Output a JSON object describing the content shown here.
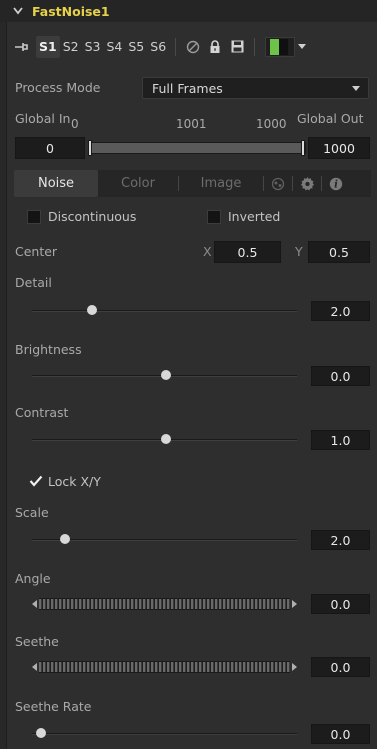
{
  "header": {
    "title": "FastNoise1"
  },
  "versions": [
    "S1",
    "S2",
    "S3",
    "S4",
    "S5",
    "S6"
  ],
  "version_active": "S1",
  "process_mode": {
    "label": "Process Mode",
    "value": "Full Frames"
  },
  "global_range": {
    "in_label": "Global In",
    "out_label": "Global Out",
    "start": "0",
    "mid": "1001",
    "end": "1000",
    "in_value": "0",
    "out_value": "1000"
  },
  "tabs": [
    "Noise",
    "Color",
    "Image"
  ],
  "tab_active": "Noise",
  "checkboxes": {
    "discontinuous": {
      "label": "Discontinuous",
      "checked": false
    },
    "inverted": {
      "label": "Inverted",
      "checked": false
    },
    "lock_xy": {
      "label": "Lock X/Y",
      "checked": true
    }
  },
  "center": {
    "label": "Center",
    "x_label": "X",
    "x_value": "0.5",
    "y_label": "Y",
    "y_value": "0.5"
  },
  "controls": {
    "detail": {
      "label": "Detail",
      "value": "2.0",
      "fraction": 0.22
    },
    "brightness": {
      "label": "Brightness",
      "value": "0.0",
      "fraction": 0.5
    },
    "contrast": {
      "label": "Contrast",
      "value": "1.0",
      "fraction": 0.5
    },
    "scale": {
      "label": "Scale",
      "value": "2.0",
      "fraction": 0.12
    },
    "angle": {
      "label": "Angle",
      "value": "0.0"
    },
    "seethe": {
      "label": "Seethe",
      "value": "0.0"
    },
    "seethe_rate": {
      "label": "Seethe Rate",
      "value": "0.0",
      "fraction": 0.0
    }
  },
  "colors": {
    "title": "#e6d24a",
    "chip_green": "#6ec24a"
  }
}
